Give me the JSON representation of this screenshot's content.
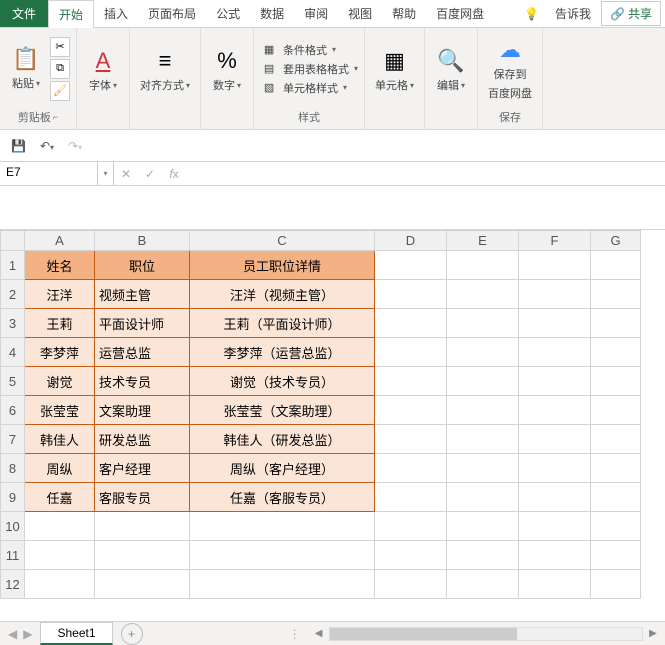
{
  "menu": {
    "file": "文件",
    "home": "开始",
    "insert": "插入",
    "page_layout": "页面布局",
    "formulas": "公式",
    "data": "数据",
    "review": "审阅",
    "view": "视图",
    "help": "帮助",
    "baidu": "百度网盘",
    "tell_me": "告诉我",
    "share": "共享"
  },
  "ribbon": {
    "clipboard": {
      "paste": "粘贴",
      "label": "剪贴板"
    },
    "font": {
      "label": "字体"
    },
    "align": {
      "label": "对齐方式"
    },
    "number": {
      "label": "数字"
    },
    "styles": {
      "cond": "条件格式",
      "table": "套用表格格式",
      "cell": "单元格样式",
      "label": "样式"
    },
    "cells": {
      "label": "单元格"
    },
    "editing": {
      "label": "编辑"
    },
    "save": {
      "btn": "保存到",
      "btn2": "百度网盘",
      "label": "保存"
    }
  },
  "name_box": "E7",
  "formula": "",
  "columns": [
    "A",
    "B",
    "C",
    "D",
    "E",
    "F",
    "G"
  ],
  "header_row": {
    "a": "姓名",
    "b": "职位",
    "c": "员工职位详情"
  },
  "rows": [
    {
      "a": "汪洋",
      "b": "视频主管",
      "c": "汪洋（视频主管）"
    },
    {
      "a": "王莉",
      "b": "平面设计师",
      "c": "王莉（平面设计师）"
    },
    {
      "a": "李梦萍",
      "b": "运营总监",
      "c": "李梦萍（运营总监）"
    },
    {
      "a": "谢觉",
      "b": "技术专员",
      "c": "谢觉（技术专员）"
    },
    {
      "a": "张莹莹",
      "b": "文案助理",
      "c": "张莹莹（文案助理）"
    },
    {
      "a": "韩佳人",
      "b": "研发总监",
      "c": "韩佳人（研发总监）"
    },
    {
      "a": "周纵",
      "b": "客户经理",
      "c": "周纵（客户经理）"
    },
    {
      "a": "任嘉",
      "b": "客服专员",
      "c": "任嘉（客服专员）"
    }
  ],
  "sheet": "Sheet1"
}
